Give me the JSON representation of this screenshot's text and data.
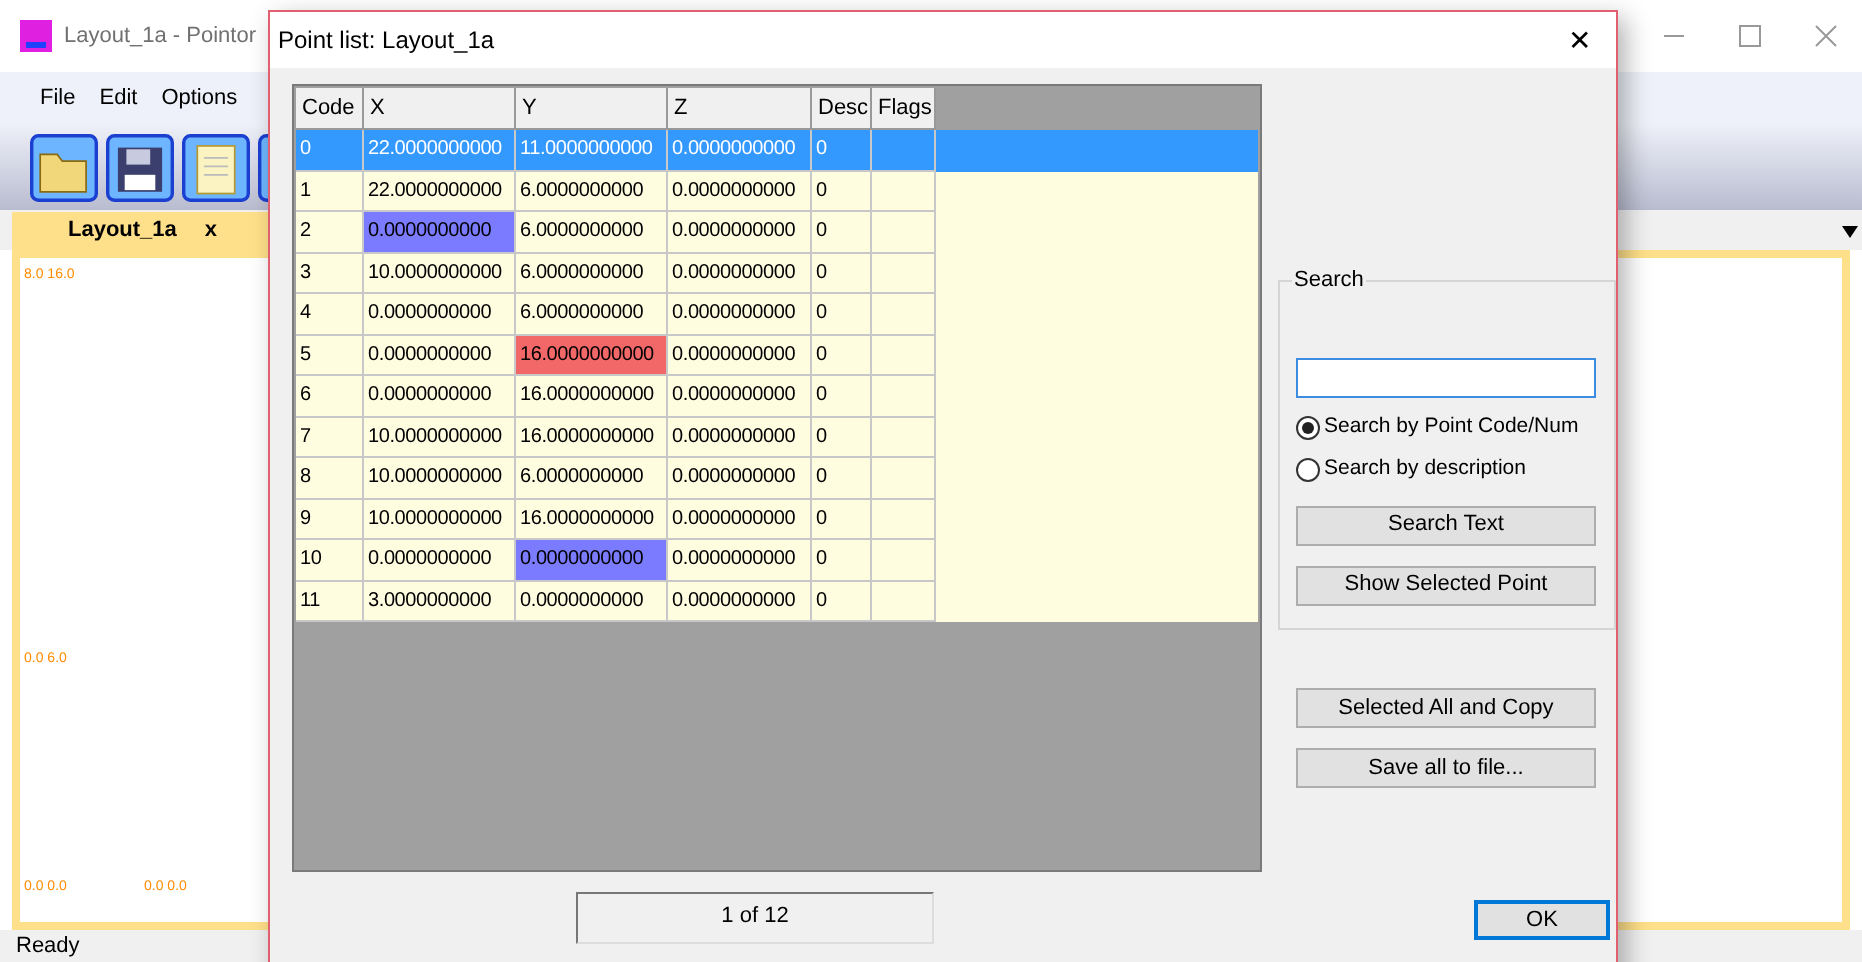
{
  "app": {
    "title": "Layout_1a - Pointor",
    "menu": [
      "File",
      "Edit",
      "Options"
    ],
    "tab": {
      "label": "Layout_1a",
      "close": "x",
      "selected": true
    },
    "canvas_labels": [
      "8.0 16.0",
      "0.0 6.0",
      "0.0 0.0",
      "0.0 0.0"
    ],
    "status_bar": "Ready"
  },
  "dialog": {
    "title": "Point list: Layout_1a",
    "close": "✕",
    "table": {
      "columns": [
        "Code",
        "X",
        "Y",
        "Z",
        "Desc",
        "Flags"
      ],
      "rows": [
        {
          "selected": true,
          "cells": [
            {
              "text": "0"
            },
            {
              "text": "22.0000000000"
            },
            {
              "text": "11.0000000000"
            },
            {
              "text": "0.0000000000"
            },
            {
              "text": "0"
            },
            {
              "text": ""
            }
          ]
        },
        {
          "selected": false,
          "cells": [
            {
              "text": "1"
            },
            {
              "text": "22.0000000000"
            },
            {
              "text": "6.0000000000"
            },
            {
              "text": "0.0000000000"
            },
            {
              "text": "0"
            },
            {
              "text": ""
            }
          ]
        },
        {
          "selected": false,
          "cells": [
            {
              "text": "2"
            },
            {
              "text": "0.0000000000",
              "color": "#7b7bff"
            },
            {
              "text": "6.0000000000"
            },
            {
              "text": "0.0000000000"
            },
            {
              "text": "0"
            },
            {
              "text": ""
            }
          ]
        },
        {
          "selected": false,
          "cells": [
            {
              "text": "3"
            },
            {
              "text": "10.0000000000"
            },
            {
              "text": "6.0000000000"
            },
            {
              "text": "0.0000000000"
            },
            {
              "text": "0"
            },
            {
              "text": ""
            }
          ]
        },
        {
          "selected": false,
          "cells": [
            {
              "text": "4"
            },
            {
              "text": "0.0000000000"
            },
            {
              "text": "6.0000000000"
            },
            {
              "text": "0.0000000000"
            },
            {
              "text": "0"
            },
            {
              "text": ""
            }
          ]
        },
        {
          "selected": false,
          "cells": [
            {
              "text": "5"
            },
            {
              "text": "0.0000000000"
            },
            {
              "text": "16.0000000000",
              "color": "#f26868"
            },
            {
              "text": "0.0000000000"
            },
            {
              "text": "0"
            },
            {
              "text": ""
            }
          ]
        },
        {
          "selected": false,
          "cells": [
            {
              "text": "6"
            },
            {
              "text": "0.0000000000"
            },
            {
              "text": "16.0000000000"
            },
            {
              "text": "0.0000000000"
            },
            {
              "text": "0"
            },
            {
              "text": ""
            }
          ]
        },
        {
          "selected": false,
          "cells": [
            {
              "text": "7"
            },
            {
              "text": "10.0000000000"
            },
            {
              "text": "16.0000000000"
            },
            {
              "text": "0.0000000000"
            },
            {
              "text": "0"
            },
            {
              "text": ""
            }
          ]
        },
        {
          "selected": false,
          "cells": [
            {
              "text": "8"
            },
            {
              "text": "10.0000000000"
            },
            {
              "text": "6.0000000000"
            },
            {
              "text": "0.0000000000"
            },
            {
              "text": "0"
            },
            {
              "text": ""
            }
          ]
        },
        {
          "selected": false,
          "cells": [
            {
              "text": "9"
            },
            {
              "text": "10.0000000000"
            },
            {
              "text": "16.0000000000"
            },
            {
              "text": "0.0000000000"
            },
            {
              "text": "0"
            },
            {
              "text": ""
            }
          ]
        },
        {
          "selected": false,
          "cells": [
            {
              "text": "10"
            },
            {
              "text": "0.0000000000"
            },
            {
              "text": "0.0000000000",
              "color": "#7b7bff"
            },
            {
              "text": "0.0000000000"
            },
            {
              "text": "0"
            },
            {
              "text": ""
            }
          ]
        },
        {
          "selected": false,
          "cells": [
            {
              "text": "11"
            },
            {
              "text": "3.0000000000"
            },
            {
              "text": "0.0000000000"
            },
            {
              "text": "0.0000000000"
            },
            {
              "text": "0"
            },
            {
              "text": ""
            }
          ]
        }
      ]
    },
    "search": {
      "title": "Search",
      "options": [
        {
          "label": "Search by Point Code/Num",
          "selected": true
        },
        {
          "label": "Search by description",
          "selected": false
        }
      ],
      "buttons": [
        "Search Text",
        "Show Selected Point"
      ]
    },
    "buttons": [
      "Selected All and Copy",
      "Save all to file..."
    ],
    "counter": "1 of 12",
    "ok": "OK"
  }
}
